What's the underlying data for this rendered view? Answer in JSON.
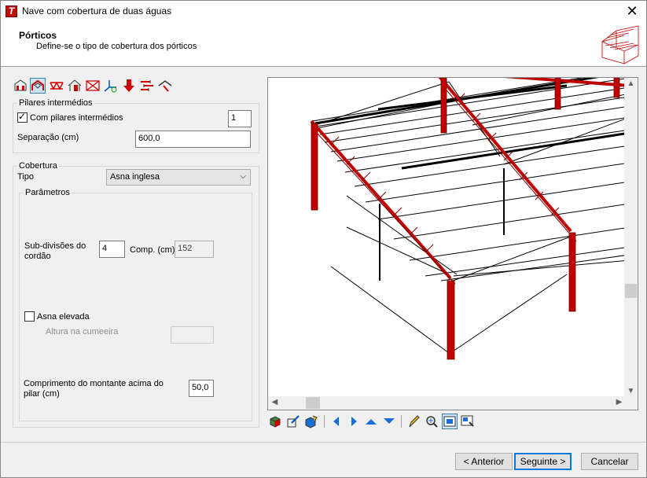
{
  "window": {
    "title": "Nave com cobertura de duas águas",
    "close_icon": "close-icon"
  },
  "header": {
    "title": "Pórticos",
    "subtitle": "Define-se o tipo de cobertura dos pórticos"
  },
  "toolbar": {
    "icons": [
      "frame-house-icon",
      "portal-frame-icon",
      "truss-icon",
      "gable-roof-icon",
      "bracing-icon",
      "axes-icon",
      "down-arrow-load-icon",
      "wind-load-icon",
      "roof-pitch-icon"
    ],
    "active_index": 1
  },
  "pilares": {
    "legend": "Pilares intermédios",
    "checkbox_label": "Com pilares intermédios",
    "checked": true,
    "count": "1",
    "separacao_label": "Separação (cm)",
    "separacao_value": "600,0"
  },
  "cobertura": {
    "legend": "Cobertura",
    "tipo_label": "Tipo",
    "tipo_value": "Asna inglesa",
    "parametros": {
      "legend": "Parâmetros",
      "subdiv_label_1": "Sub-divisões do",
      "subdiv_label_2": "cordão",
      "subdiv_value": "4",
      "comp_label": "Comp. (cm)",
      "comp_value": "152",
      "asna_elevada_label": "Asna elevada",
      "asna_elevada_checked": false,
      "altura_label": "Altura na cumeeira",
      "altura_value": "",
      "montante_label_1": "Comprimento do montante acima do",
      "montante_label_2": "pilar (cm)",
      "montante_value": "50,0"
    }
  },
  "viewer_toolbar": {
    "icons": [
      "cube-view-icon",
      "edit-view-icon",
      "render-cube-icon",
      "arrow-left-icon",
      "arrow-right-icon",
      "arrow-up-icon",
      "arrow-down-icon",
      "select-pen-icon",
      "zoom-icon",
      "zoom-window-icon",
      "zoom-extents-icon"
    ],
    "active_index": 9
  },
  "buttons": {
    "back": "< Anterior",
    "next": "Seguinte >",
    "cancel": "Cancelar"
  },
  "colors": {
    "steel": "#c00000",
    "accent": "#0078d7"
  }
}
